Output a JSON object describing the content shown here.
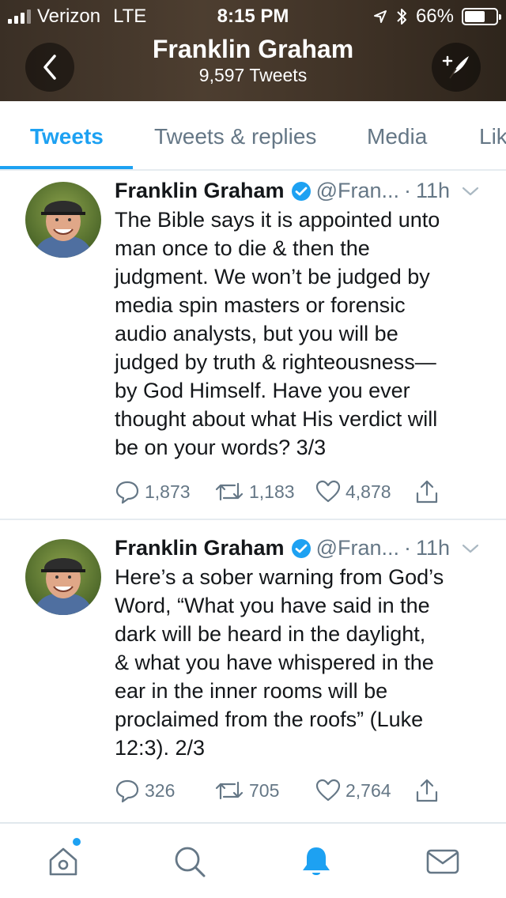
{
  "status_bar": {
    "carrier": "Verizon",
    "network": "LTE",
    "time": "8:15 PM",
    "battery": "66%",
    "battery_level": 0.66
  },
  "header": {
    "title": "Franklin Graham",
    "subtitle": "9,597 Tweets"
  },
  "tabs": [
    {
      "label": "Tweets"
    },
    {
      "label": "Tweets & replies"
    },
    {
      "label": "Media"
    },
    {
      "label": "Lik"
    }
  ],
  "tweets": [
    {
      "name": "Franklin Graham",
      "handle": "@Fran...",
      "time": "11h",
      "lines": [
        "The Bible says it is appointed unto",
        "man once to die & then the",
        "judgment. We won’t be judged by",
        "media spin masters or forensic",
        "audio analysts, but you will be",
        "judged by truth & righteousness—",
        "by God Himself. Have you ever",
        "thought about what His verdict will",
        "be on your words? 3/3"
      ],
      "replies": "1,873",
      "retweets": "1,183",
      "likes": "4,878"
    },
    {
      "name": "Franklin Graham",
      "handle": "@Fran...",
      "time": "11h",
      "lines": [
        "Here’s a sober warning from God’s",
        "Word, “What you have said in the",
        "dark will be heard in the daylight,",
        "& what you have whispered in the",
        "ear in the inner rooms will be",
        "proclaimed from the roofs” (Luke",
        "12:3). 2/3"
      ],
      "replies": "326",
      "retweets": "705",
      "likes": "2,764"
    }
  ],
  "icons": {
    "back": "chevron-left-icon",
    "compose": "compose-tweet-icon",
    "verified": "verified-badge-icon",
    "reply": "reply-icon",
    "retweet": "retweet-icon",
    "like": "heart-icon",
    "share": "share-icon",
    "home": "home-icon",
    "search": "search-icon",
    "notifications": "bell-icon",
    "messages": "mail-icon"
  },
  "colors": {
    "accent": "#1da1f2",
    "text": "#14171a",
    "secondary_text": "#657786",
    "divider": "#e6ecf0"
  }
}
